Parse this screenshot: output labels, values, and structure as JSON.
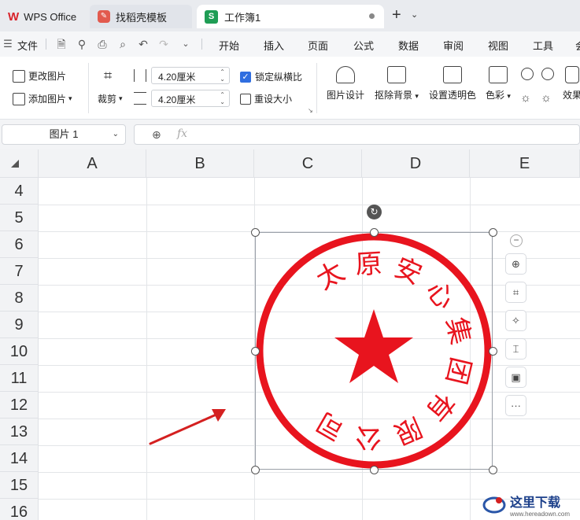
{
  "tabs": {
    "app": "WPS Office",
    "template_tab": "找稻壳模板",
    "workbook_tab": "工作簿1",
    "new_tab": "+",
    "new_tab_dropdown": "⌄"
  },
  "menubar": {
    "file": "文件",
    "items": [
      "开始",
      "插入",
      "页面",
      "公式",
      "数据",
      "审阅",
      "视图",
      "工具",
      "会"
    ]
  },
  "ribbon": {
    "change_image": "更改图片",
    "add_image": "添加图片",
    "crop": "裁剪",
    "height_value": "4.20厘米",
    "width_value": "4.20厘米",
    "lock_ratio": "锁定纵横比",
    "reset_size": "重设大小",
    "image_design": "图片设计",
    "remove_bg": "抠除背景",
    "set_transparent": "设置透明色",
    "color": "色彩",
    "effect": "效果"
  },
  "formula_bar": {
    "name_box": "图片 1",
    "fx": "fx"
  },
  "grid": {
    "columns": [
      "A",
      "B",
      "C",
      "D",
      "E"
    ],
    "rows": [
      "4",
      "5",
      "6",
      "7",
      "8",
      "9",
      "10",
      "11",
      "12",
      "13",
      "14",
      "15",
      "16"
    ]
  },
  "stamp": {
    "text": "太原安心集团有限公司",
    "color": "#e8141e"
  },
  "watermark": {
    "text": "这里下载",
    "url": "www.hereadown.com"
  },
  "colors": {
    "accent_green": "#1f9d55",
    "arrow_red": "#d42020"
  }
}
